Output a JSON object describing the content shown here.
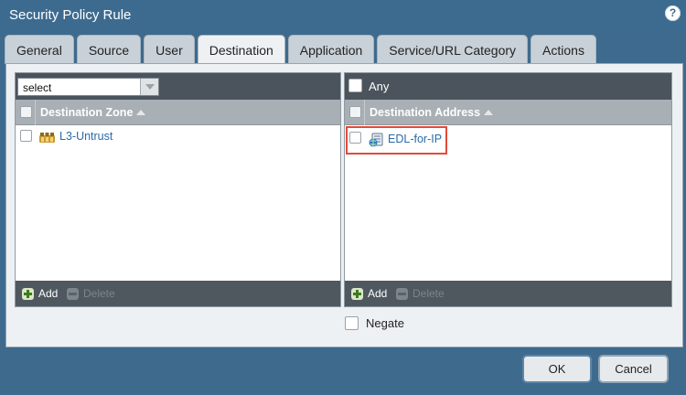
{
  "window": {
    "title": "Security Policy Rule",
    "help_symbol": "?"
  },
  "tabs": [
    {
      "label": "General"
    },
    {
      "label": "Source"
    },
    {
      "label": "User"
    },
    {
      "label": "Destination",
      "active": true
    },
    {
      "label": "Application"
    },
    {
      "label": "Service/URL Category"
    },
    {
      "label": "Actions"
    }
  ],
  "left_box": {
    "select_value": "select",
    "column_header": "Destination Zone",
    "rows": [
      {
        "label": "L3-Untrust",
        "icon": "zone-icon"
      }
    ],
    "add_label": "Add",
    "delete_label": "Delete"
  },
  "right_box": {
    "any_label": "Any",
    "column_header": "Destination Address",
    "rows": [
      {
        "label": "EDL-for-IP",
        "icon": "edl-object-icon",
        "highlighted": true,
        "highlight_color": "#e14b3a"
      }
    ],
    "add_label": "Add",
    "delete_label": "Delete"
  },
  "negate_label": "Negate",
  "buttons": {
    "ok": "OK",
    "cancel": "Cancel"
  },
  "colors": {
    "title_bar": "#3d6b90",
    "link": "#2a6aa8",
    "add_green": "#3f7b1c"
  }
}
